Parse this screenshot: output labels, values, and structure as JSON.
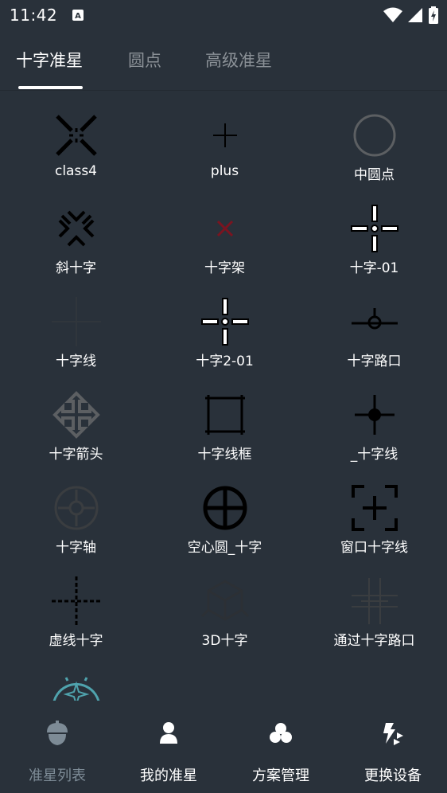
{
  "status_bar": {
    "time": "11:42",
    "notification_icon": "a-box-icon",
    "icons": [
      "wifi-icon",
      "signal-icon",
      "battery-icon"
    ]
  },
  "tabs": [
    {
      "label": "十字准星",
      "active": true
    },
    {
      "label": "圆点",
      "active": false
    },
    {
      "label": "高级准星",
      "active": false
    }
  ],
  "crosshairs": [
    {
      "label": "class4",
      "icon": "class4-crosshair-icon"
    },
    {
      "label": "plus",
      "icon": "plus-crosshair-icon"
    },
    {
      "label": "中圆点",
      "icon": "circle-crosshair-icon"
    },
    {
      "label": "斜十字",
      "icon": "diagonal-cross-icon"
    },
    {
      "label": "十字架",
      "icon": "small-x-icon"
    },
    {
      "label": "十字-01",
      "icon": "cross-01-icon"
    },
    {
      "label": "十字线",
      "icon": "faint-cross-icon"
    },
    {
      "label": "十字2-01",
      "icon": "cross-2-01-icon"
    },
    {
      "label": "十字路口",
      "icon": "crossroad-icon"
    },
    {
      "label": "十字箭头",
      "icon": "cross-arrow-icon"
    },
    {
      "label": "十字线框",
      "icon": "cross-frame-icon"
    },
    {
      "label": "_十字线",
      "icon": "dot-cross-icon"
    },
    {
      "label": "十字轴",
      "icon": "cross-axis-icon"
    },
    {
      "label": "空心圆_十字",
      "icon": "hollow-circle-cross-icon"
    },
    {
      "label": "窗口十字线",
      "icon": "window-cross-icon"
    },
    {
      "label": "虚线十字",
      "icon": "dashed-cross-icon"
    },
    {
      "label": "3D十字",
      "icon": "cube-cross-icon"
    },
    {
      "label": "通过十字路口",
      "icon": "grid-cross-icon"
    },
    {
      "label": "",
      "icon": "compass-crosshair-icon"
    }
  ],
  "bottom_nav": [
    {
      "label": "准星列表",
      "icon": "acorn-icon",
      "active": true
    },
    {
      "label": "我的准星",
      "icon": "user-icon",
      "active": false
    },
    {
      "label": "方案管理",
      "icon": "clover-icon",
      "active": false
    },
    {
      "label": "更换设备",
      "icon": "swap-device-icon",
      "active": false
    }
  ],
  "colors": {
    "background": "#29313a",
    "active_text": "#ffffff",
    "inactive_tab": "#8a9096",
    "active_nav": "#7d8b96"
  }
}
